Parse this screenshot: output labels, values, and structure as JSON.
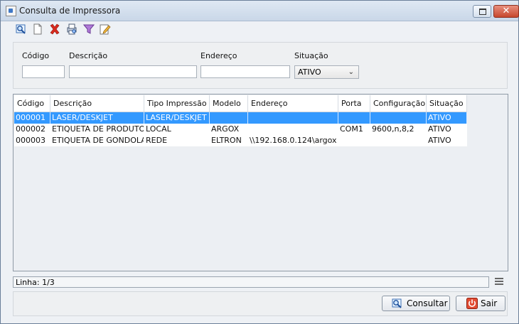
{
  "window": {
    "title": "Consulta de Impressora"
  },
  "toolbar": {
    "items": [
      {
        "name": "search-icon"
      },
      {
        "name": "new-document-icon"
      },
      {
        "name": "delete-x-icon"
      },
      {
        "name": "print-preview-icon"
      },
      {
        "name": "filter-icon"
      },
      {
        "name": "edit-icon"
      }
    ]
  },
  "filters": {
    "codigo_label": "Código",
    "descricao_label": "Descrição",
    "endereco_label": "Endereço",
    "situacao_label": "Situação",
    "codigo_value": "",
    "descricao_value": "",
    "endereco_value": "",
    "situacao_value": "ATIVO"
  },
  "table": {
    "columns": [
      "Código",
      "Descrição",
      "Tipo Impressão",
      "Modelo",
      "Endereço",
      "Porta",
      "Configuração",
      "Situação"
    ],
    "rows": [
      [
        "000001",
        "LASER/DESKJET",
        "LASER/DESKJET",
        "",
        "",
        "",
        "",
        "ATIVO"
      ],
      [
        "000002",
        "ETIQUETA DE PRODUTO",
        "LOCAL",
        "ARGOX",
        "",
        "COM1",
        "9600,n,8,2",
        "ATIVO"
      ],
      [
        "000003",
        "ETIQUETA DE GONDOLA",
        "REDE",
        "ELTRON",
        "\\\\192.168.0.124\\argox",
        "",
        "",
        "ATIVO"
      ]
    ],
    "selected_row": 0
  },
  "status": {
    "text": "Linha: 1/3"
  },
  "buttons": {
    "consultar": "Consultar",
    "sair": "Sair"
  },
  "colors": {
    "selection": "#3399ff",
    "close_button": "#c7472d"
  }
}
